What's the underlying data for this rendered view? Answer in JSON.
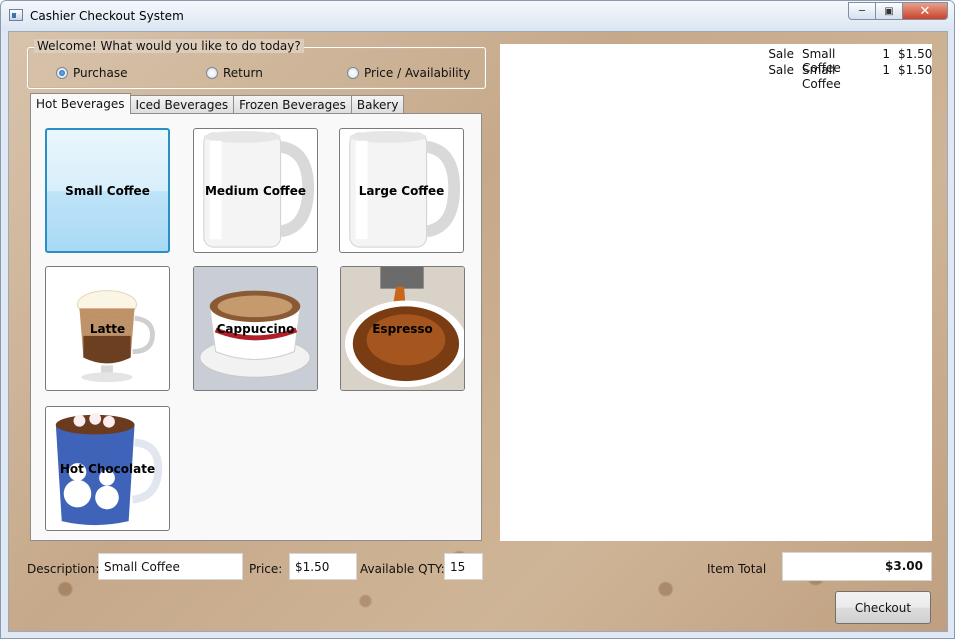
{
  "window": {
    "title": "Cashier Checkout System",
    "controls": {
      "minimize_icon": "minimize-icon",
      "maximize_icon": "maximize-icon",
      "close_icon": "close-icon"
    }
  },
  "mode": {
    "title": "Welcome! What would you like to do today?",
    "options": [
      {
        "label": "Purchase",
        "checked": true
      },
      {
        "label": "Return",
        "checked": false
      },
      {
        "label": "Price / Availability",
        "checked": false
      }
    ]
  },
  "tabs": [
    {
      "label": "Hot Beverages",
      "active": true
    },
    {
      "label": "Iced Beverages",
      "active": false
    },
    {
      "label": "Frozen Beverages",
      "active": false
    },
    {
      "label": "Bakery",
      "active": false
    }
  ],
  "products": [
    {
      "label": "Small Coffee",
      "selected": true
    },
    {
      "label": "Medium Coffee",
      "selected": false
    },
    {
      "label": "Large Coffee",
      "selected": false
    },
    {
      "label": "Latte",
      "selected": false
    },
    {
      "label": "Cappuccino",
      "selected": false
    },
    {
      "label": "Espresso",
      "selected": false
    },
    {
      "label": "Hot Chocolate",
      "selected": false
    }
  ],
  "receipt": {
    "lines": [
      {
        "type": "Sale",
        "item": "Small Coffee",
        "qty": "1",
        "price": "$1.50"
      },
      {
        "type": "Sale",
        "item": "Small Coffee",
        "qty": "1",
        "price": "$1.50"
      }
    ]
  },
  "details": {
    "description_label": "Description:",
    "description_value": "Small Coffee",
    "price_label": "Price:",
    "price_value": "$1.50",
    "qty_label": "Available QTY:",
    "qty_value": "15"
  },
  "totals": {
    "label": "Item Total",
    "value": "$3.00"
  },
  "checkout_label": "Checkout",
  "colors": {
    "selected_tile": "#bfe4f8",
    "selected_border": "#2c8fc4",
    "close_button": "#c8432a"
  }
}
